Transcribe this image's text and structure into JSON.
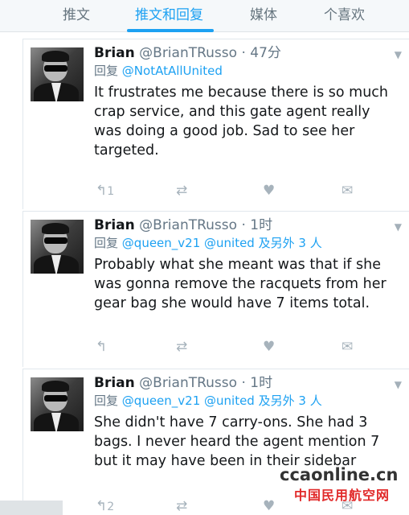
{
  "tabs": [
    {
      "label": "推文"
    },
    {
      "label": "推文和回复"
    },
    {
      "label": "媒体"
    },
    {
      "label": "个喜欢"
    }
  ],
  "tweets": [
    {
      "name": "Brian",
      "handle": "@BrianTRusso",
      "time": "· 47分",
      "reply_prefix": "回复",
      "reply_mentions": "@NotAtAllUnited",
      "reply_suffix": "",
      "text": "It frustrates me because there is so much crap service, and this gate agent really was doing a good job. Sad to see her targeted.",
      "reply_count": "1",
      "retweet_count": "",
      "like_count": ""
    },
    {
      "name": "Brian",
      "handle": "@BrianTRusso",
      "time": "· 1时",
      "reply_prefix": "回复",
      "reply_mentions": "@queen_v21 @united",
      "reply_suffix": "及另外 3 人",
      "text": "Probably what she meant was that if she was gonna remove the racquets from her gear bag she would have 7 items total.",
      "reply_count": "",
      "retweet_count": "",
      "like_count": ""
    },
    {
      "name": "Brian",
      "handle": "@BrianTRusso",
      "time": "· 1时",
      "reply_prefix": "回复",
      "reply_mentions": "@queen_v21 @united",
      "reply_suffix": "及另外 3 人",
      "text": "She didn't have 7 carry-ons. She had 3 bags. I never heard the agent mention 7 but it may have been in their sidebar",
      "reply_count": "2",
      "retweet_count": "",
      "like_count": ""
    }
  ],
  "watermark": {
    "site": "ccaonline.cn",
    "cn_text": "中国民用航空网"
  },
  "icons": {
    "reply": "reply-icon",
    "retweet": "retweet-icon",
    "like": "heart-icon",
    "dm": "envelope-icon",
    "more": "chevron-down-icon"
  },
  "colors": {
    "accent": "#1da1f2",
    "text": "#14171a",
    "muted": "#657786",
    "icon": "#a7b3bc"
  }
}
